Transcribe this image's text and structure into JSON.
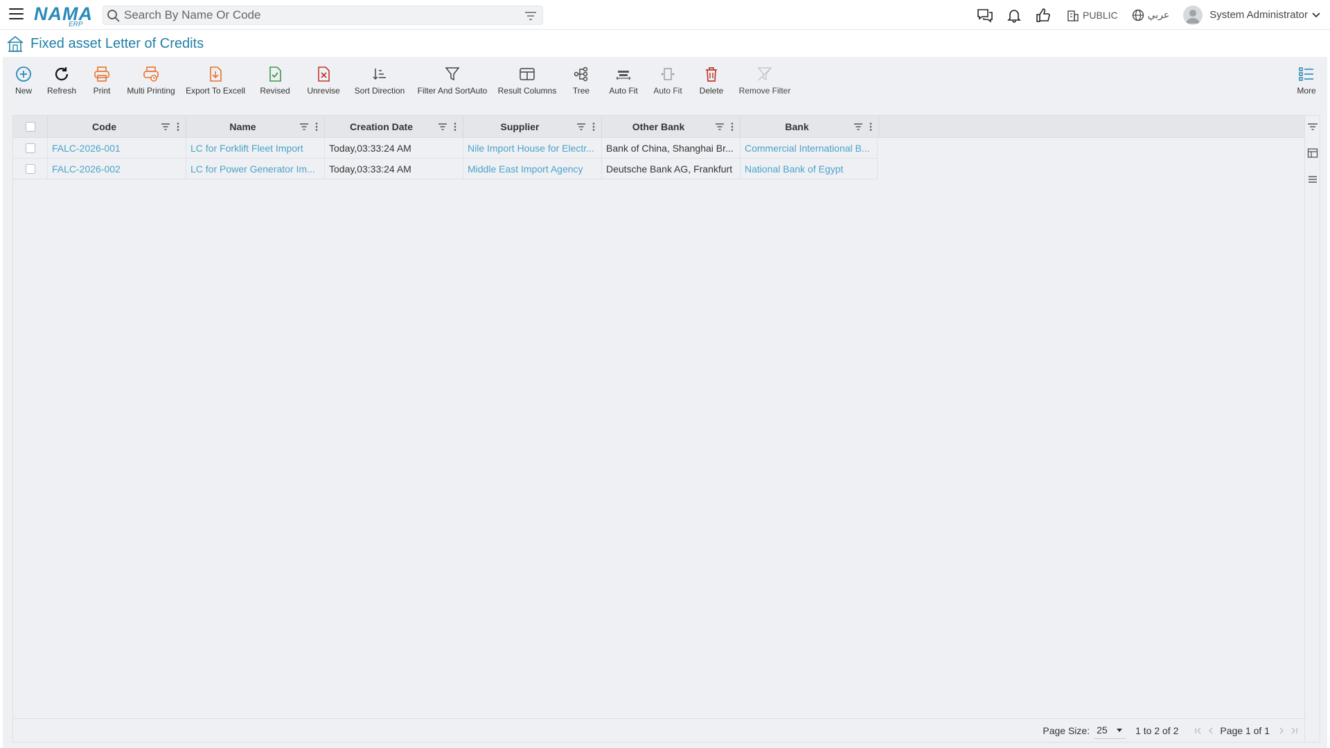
{
  "header": {
    "logo_text": "NAMA",
    "logo_sub": "ERP",
    "search_placeholder": "Search By Name Or Code",
    "branch": "PUBLIC",
    "language": "عربي",
    "user": "System Administrator"
  },
  "page": {
    "title": "Fixed asset Letter of Credits"
  },
  "toolbar": {
    "items": [
      {
        "label": "New",
        "icon": "plus-circle-icon"
      },
      {
        "label": "Refresh",
        "icon": "refresh-icon"
      },
      {
        "label": "Print",
        "icon": "print-icon"
      },
      {
        "label": "Multi Printing",
        "icon": "multi-print-icon"
      },
      {
        "label": "Export To Excell",
        "icon": "export-icon"
      },
      {
        "label": "Revised",
        "icon": "revised-icon"
      },
      {
        "label": "Unrevise",
        "icon": "unrevise-icon"
      },
      {
        "label": "Sort Direction",
        "icon": "sort-icon"
      },
      {
        "label": "Filter And SortAuto",
        "icon": "filter-icon"
      },
      {
        "label": "Result Columns",
        "icon": "columns-icon"
      },
      {
        "label": "Tree",
        "icon": "tree-icon"
      },
      {
        "label": "Auto Fit",
        "icon": "auto-fit-icon"
      },
      {
        "label": "Auto Fit",
        "icon": "auto-fit-alt-icon"
      },
      {
        "label": "Delete",
        "icon": "trash-icon"
      },
      {
        "label": "Remove Filter",
        "icon": "remove-filter-icon"
      }
    ],
    "more_label": "More"
  },
  "grid": {
    "columns": [
      "Code",
      "Name",
      "Creation Date",
      "Supplier",
      "Other Bank",
      "Bank"
    ],
    "rows": [
      [
        "FALC-2026-001",
        "LC for Forklift Fleet Import",
        "Today,03:33:24 AM",
        "Nile Import House for Electr...",
        "Bank of China, Shanghai Br...",
        "Commercial International B..."
      ],
      [
        "FALC-2026-002",
        "LC for Power Generator Im...",
        "Today,03:33:24 AM",
        "Middle East Import Agency",
        "Deutsche Bank AG, Frankfurt",
        "National Bank of Egypt"
      ]
    ]
  },
  "footer": {
    "page_size_label": "Page Size:",
    "page_size": "25",
    "range": "1 to 2 of 2",
    "page_text": "Page 1 of 1"
  },
  "colors": {
    "accent": "#1f7fa6",
    "link": "#4ba3c9",
    "orange": "#e8742c",
    "green": "#3c9a4b",
    "red": "#c0392b"
  }
}
